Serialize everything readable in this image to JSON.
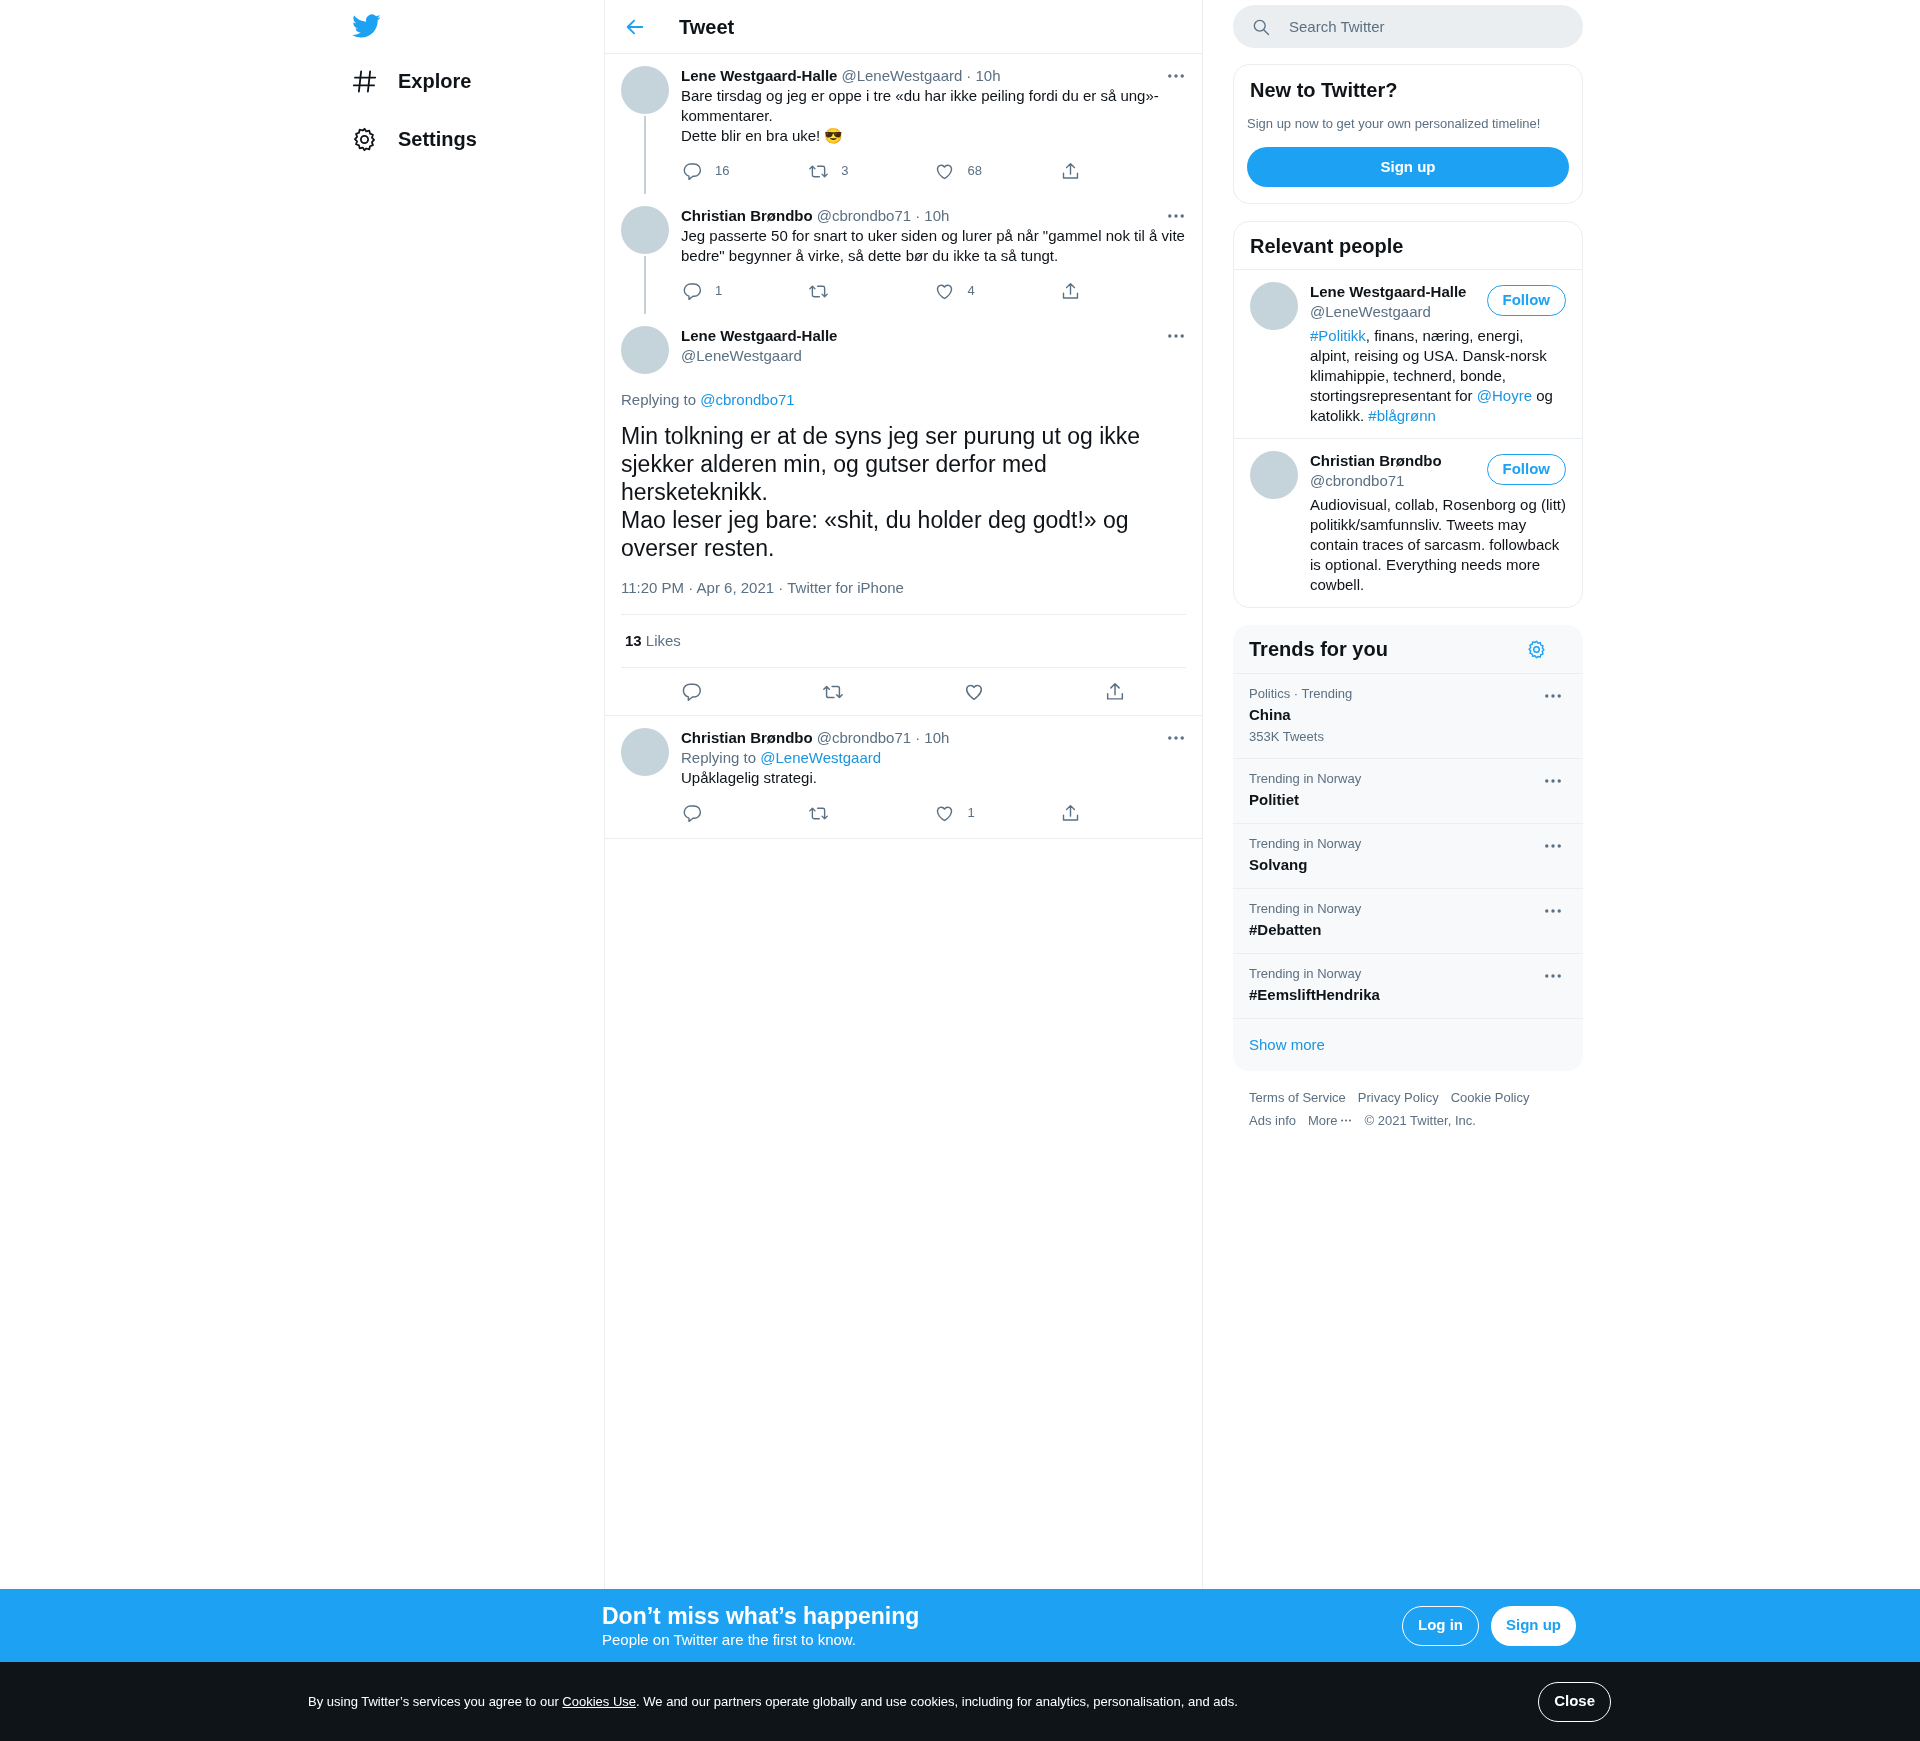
{
  "nav": {
    "items": [
      {
        "kind": "hash",
        "label": "Explore"
      },
      {
        "kind": "gear",
        "label": "Settings"
      }
    ]
  },
  "header": {
    "title": "Tweet"
  },
  "thread": [
    {
      "name": "Lene Westgaard-Halle",
      "handle": "@LeneWestgaard",
      "time": "· 10h",
      "connected": true,
      "text": "Bare tirsdag og jeg er oppe i tre «du har ikke peiling fordi du er så ung»-kommentarer.\nDette blir en bra uke! 😎",
      "stats": [
        {
          "kind": "reply",
          "count": "16"
        },
        {
          "kind": "retweet",
          "count": "3"
        },
        {
          "kind": "like",
          "count": "68"
        },
        {
          "kind": "share"
        }
      ]
    },
    {
      "name": "Christian Brøndbo",
      "handle": "@cbrondbo71",
      "time": "· 10h",
      "connected": true,
      "text": "Jeg passerte 50 for snart to uker siden og lurer på når \"gammel nok til å vite bedre\" begynner å virke, så dette bør du ikke ta så tungt.",
      "stats": [
        {
          "kind": "reply",
          "count": "1"
        },
        {
          "kind": "retweet"
        },
        {
          "kind": "like",
          "count": "4"
        },
        {
          "kind": "share"
        }
      ]
    }
  ],
  "focus": {
    "name": "Lene Westgaard-Halle",
    "handle": "@LeneWestgaard",
    "replying": {
      "prefix": "Replying to",
      "handle": "@cbrondbo71"
    },
    "text": "Min tolkning er at de syns jeg ser purung ut og ikke sjekker alderen min, og gutser derfor med hersketeknikk.\nMao leser jeg bare: «shit, du holder deg godt!» og overser resten.",
    "meta": "11:20 PM · Apr 6, 2021 · Twitter for iPhone",
    "likes_count": "13",
    "likes_label": "Likes",
    "actions": [
      {
        "kind": "reply"
      },
      {
        "kind": "retweet"
      },
      {
        "kind": "like"
      },
      {
        "kind": "share"
      }
    ]
  },
  "replies": [
    {
      "name": "Christian Brøndbo",
      "handle": "@cbrondbo71",
      "time": "· 10h",
      "replying": {
        "prefix": "Replying to",
        "handle": "@LeneWestgaard"
      },
      "text": "Upåklagelig strategi.",
      "stats": [
        {
          "kind": "reply"
        },
        {
          "kind": "retweet"
        },
        {
          "kind": "like",
          "count": "1"
        },
        {
          "kind": "share"
        }
      ]
    }
  ],
  "search": {
    "placeholder": "Search Twitter"
  },
  "signup_card": {
    "title": "New to Twitter?",
    "text": "Sign up now to get your own personalized timeline!",
    "button": "Sign up"
  },
  "relevant_people": {
    "title": "Relevant people",
    "people": [
      {
        "name": "Lene Westgaard-Halle",
        "handle": "@LeneWestgaard",
        "follow": "Follow",
        "bio": [
          {
            "text": "#Politikk",
            "link": true
          },
          {
            "text": ", finans, næring, energi, alpint, reising og USA. Dansk-norsk klimahippie, technerd, bonde, stortingsrepresentant for ",
            "link": false
          },
          {
            "text": "@Hoyre",
            "link": true
          },
          {
            "text": " og katolikk. ",
            "link": false
          },
          {
            "text": "#blågrønn",
            "link": true
          }
        ]
      },
      {
        "name": "Christian Brøndbo",
        "handle": "@cbrondbo71",
        "follow": "Follow",
        "bio": [
          {
            "text": "Audiovisual, collab, Rosenborg og (litt) politikk/samfunnsliv. Tweets may contain traces of sarcasm. followback is optional. Everything needs more cowbell.",
            "link": false
          }
        ]
      }
    ]
  },
  "trends": {
    "title": "Trends for you",
    "items": [
      {
        "context": "Politics · Trending",
        "name": "China",
        "count": "353K Tweets"
      },
      {
        "context": "Trending in Norway",
        "name": "Politiet"
      },
      {
        "context": "Trending in Norway",
        "name": "Solvang"
      },
      {
        "context": "Trending in Norway",
        "name": "#Debatten"
      },
      {
        "context": "Trending in Norway",
        "name": "#EemsliftHendrika"
      }
    ],
    "show_more": "Show more"
  },
  "footer": {
    "links": [
      {
        "label": "Terms of Service",
        "more": false
      },
      {
        "label": "Privacy Policy",
        "more": false
      },
      {
        "label": "Cookie Policy",
        "more": false
      },
      {
        "label": "Ads info",
        "more": false
      },
      {
        "label": "More",
        "more": true
      }
    ],
    "copyright": "© 2021 Twitter, Inc."
  },
  "banner": {
    "title": "Don’t miss what’s happening",
    "subtitle": "People on Twitter are the first to know.",
    "login": "Log in",
    "signup": "Sign up"
  },
  "cookie_bar": {
    "text": [
      {
        "text": "By using Twitter’s services you agree to our ",
        "link": false
      },
      {
        "text": "Cookies Use",
        "link": true
      },
      {
        "text": ". We and our partners operate globally and use cookies, including for analytics, personalisation, and ads.",
        "link": false
      }
    ],
    "button": "Close"
  }
}
